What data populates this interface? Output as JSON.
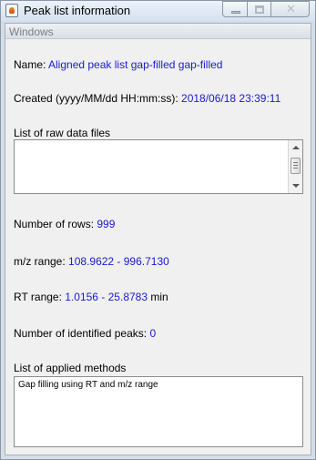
{
  "window": {
    "title": "Peak list information",
    "controls": {
      "close": "✕"
    }
  },
  "group": {
    "title": "Windows"
  },
  "name": {
    "label": "Name:",
    "value": "Aligned peak list gap-filled gap-filled"
  },
  "created": {
    "label": "Created (yyyy/MM/dd HH:mm:ss):",
    "value": "2018/06/18 23:39:11"
  },
  "raw_files": {
    "label": "List of raw data files",
    "items": []
  },
  "rows": {
    "label": "Number of rows:",
    "value": "999"
  },
  "mz_range": {
    "label": "m/z range:",
    "value": "108.9622 - 996.7130"
  },
  "rt_range": {
    "label": "RT range:",
    "value": "1.0156 - 25.8783",
    "unit": "min"
  },
  "identified": {
    "label": "Number of identified peaks:",
    "value": "0"
  },
  "methods": {
    "label": "List of applied methods",
    "items": [
      "Gap filling using RT and m/z range"
    ]
  }
}
